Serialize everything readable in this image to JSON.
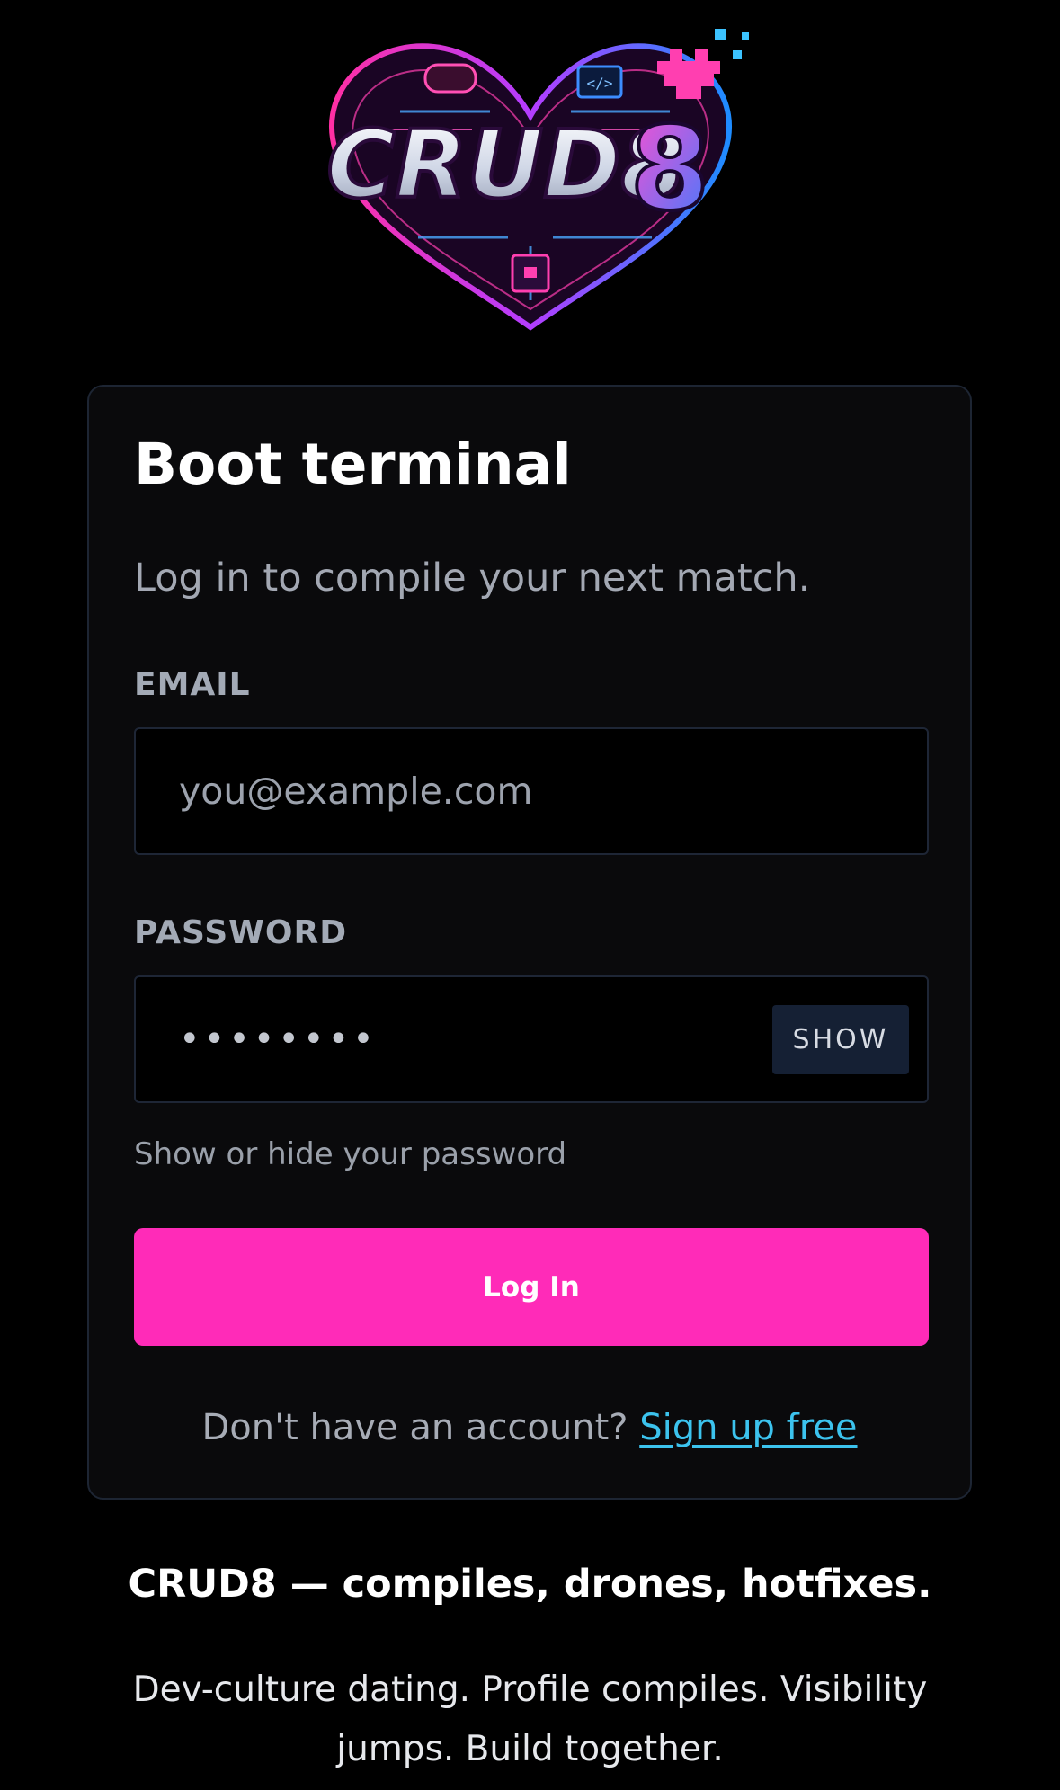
{
  "logo": {
    "text": "CRUD8"
  },
  "login": {
    "title": "Boot terminal",
    "subtitle": "Log in to compile your next match.",
    "email": {
      "label": "EMAIL",
      "placeholder": "you@example.com",
      "value": ""
    },
    "password": {
      "label": "PASSWORD",
      "value": "••••••••",
      "toggle_label": "SHOW",
      "hint": "Show or hide your password"
    },
    "submit_label": "Log In",
    "signup_prompt": "Don't have an account?",
    "signup_link": "Sign up free"
  },
  "footer": {
    "tagline": "CRUD8 — compiles, drones, hotfixes.",
    "description": "Dev-culture dating. Profile compiles. Visibility jumps. Build together."
  },
  "colors": {
    "background": "#000000",
    "card": "#0a0a0c",
    "card_border": "#1d2533",
    "accent_pink": "#ff2bb8",
    "link_cyan": "#3cc3ee",
    "toggle_bg": "#152034"
  }
}
